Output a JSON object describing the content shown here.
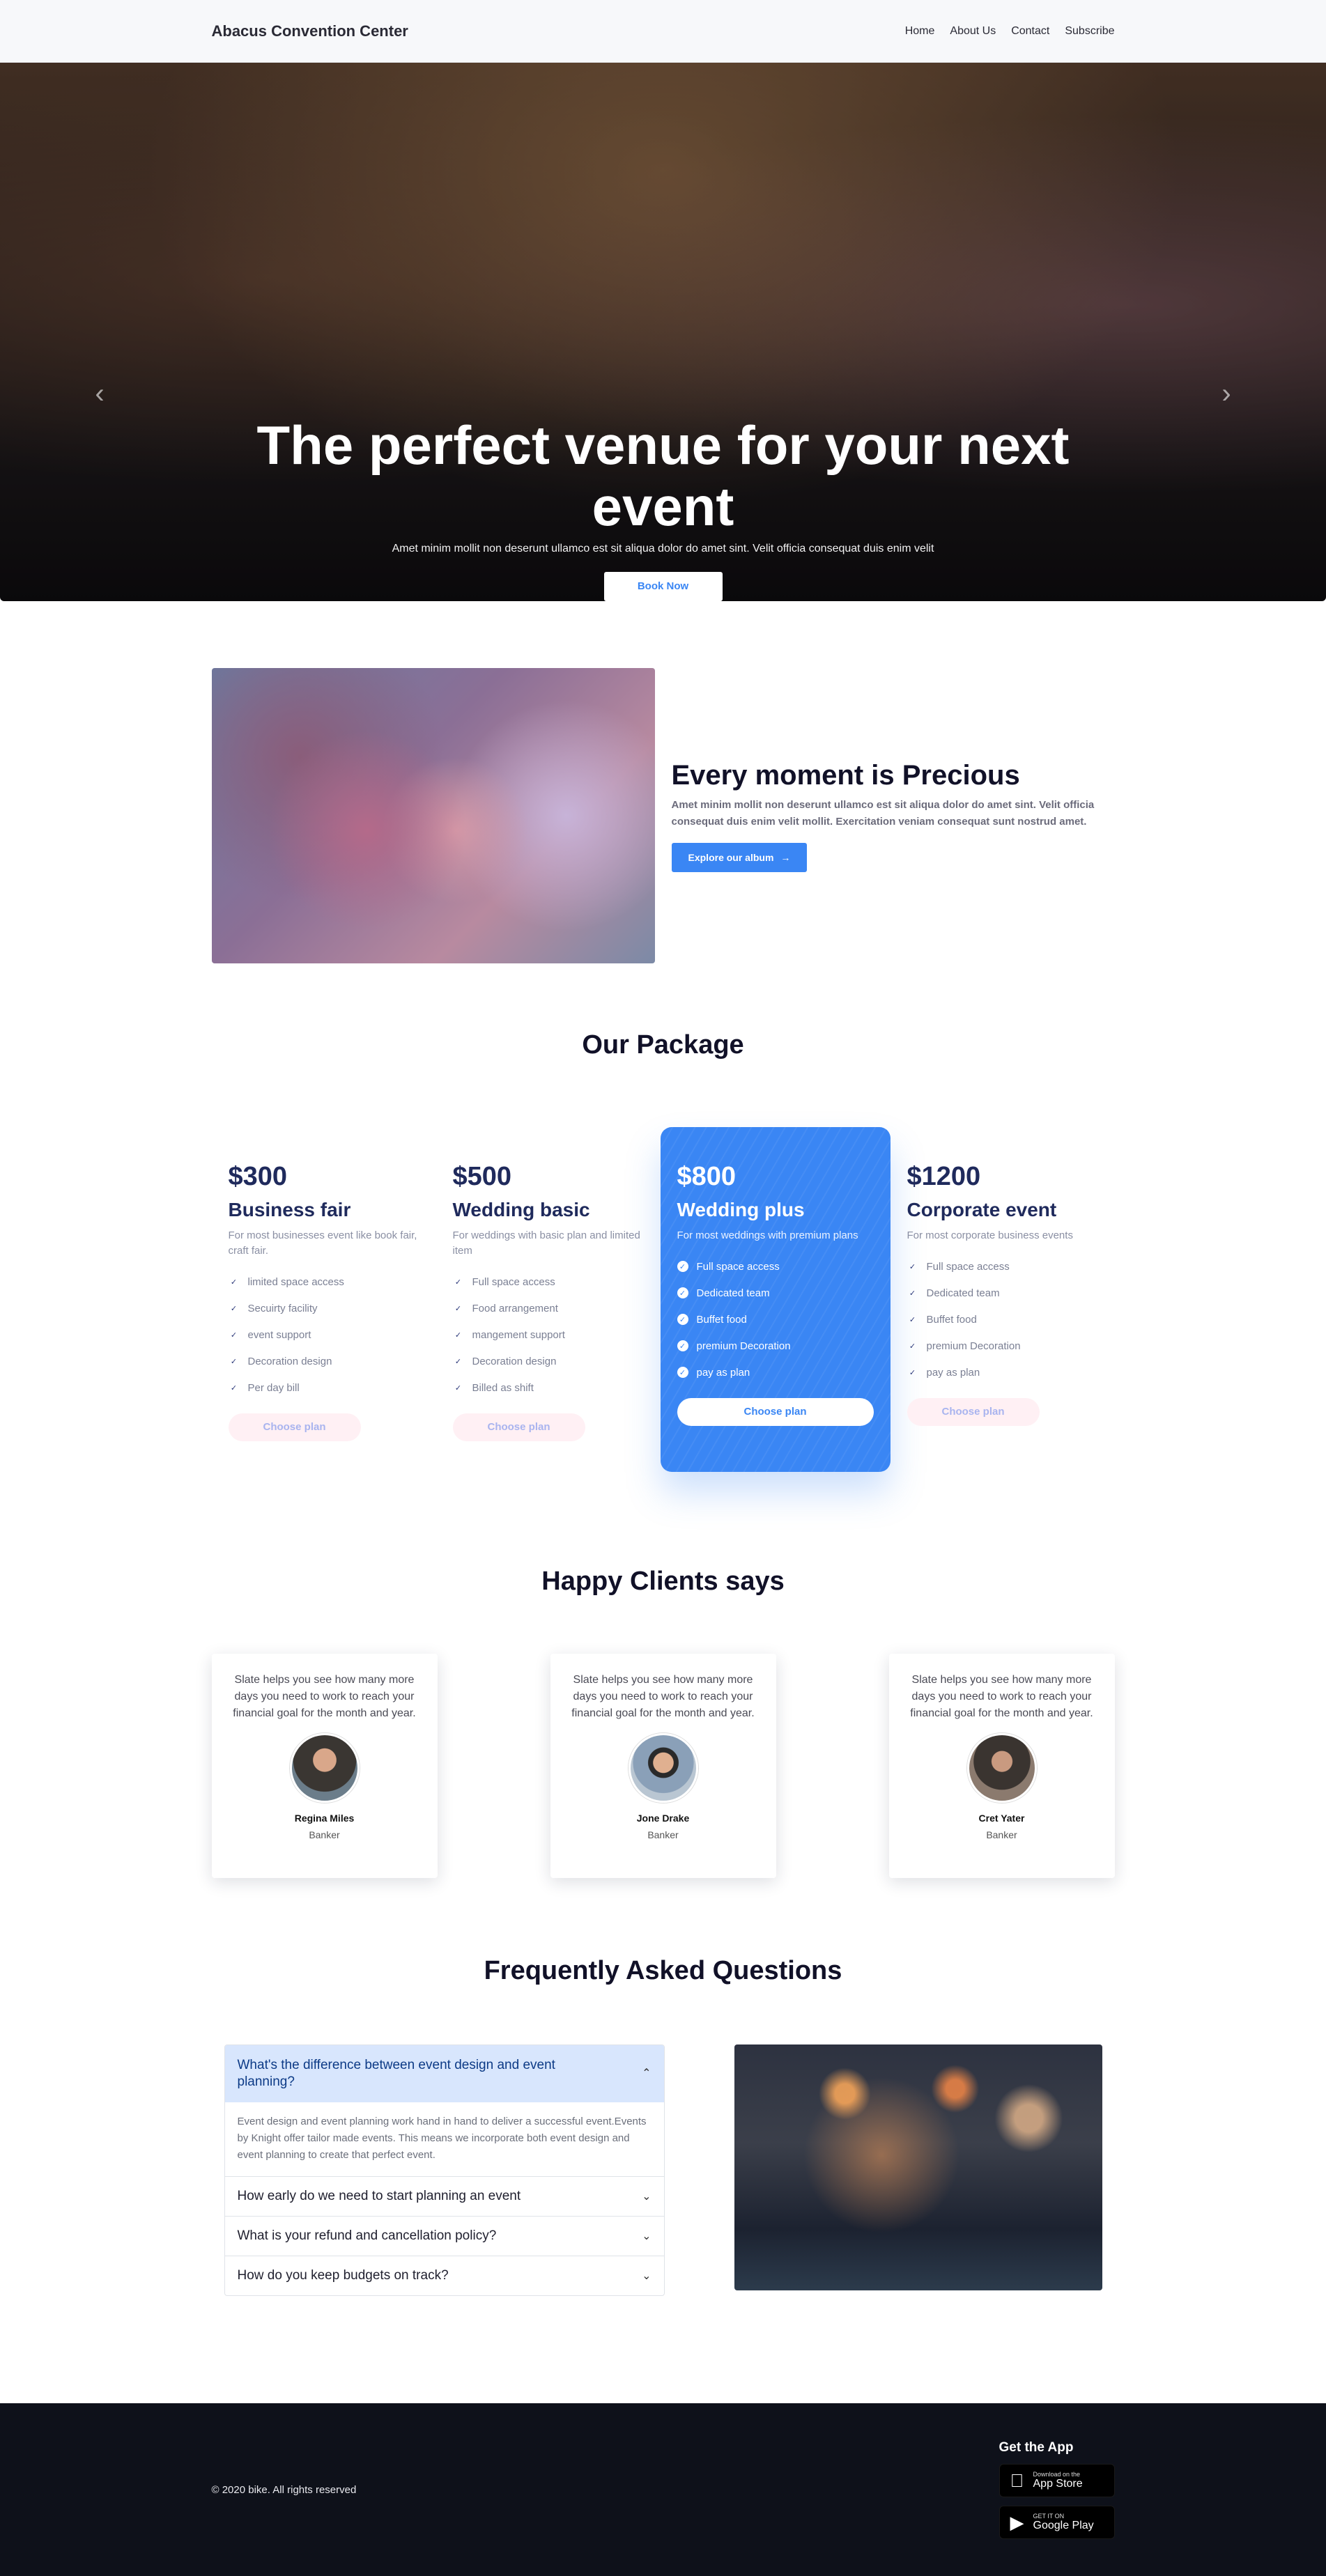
{
  "nav": {
    "brand": "Abacus Convention Center",
    "links": [
      "Home",
      "About Us",
      "Contact",
      "Subscribe"
    ]
  },
  "hero": {
    "title": "The perfect venue for your next event",
    "subtitle": "Amet minim mollit non deserunt ullamco est sit aliqua dolor do amet sint. Velit officia consequat duis enim velit",
    "button": "Book Now",
    "prev_icon": "chevron-left-icon",
    "next_icon": "chevron-right-icon",
    "slide_count": 4,
    "active_slide": 1
  },
  "about": {
    "title": "Every moment is Precious",
    "description": "Amet minim mollit non deserunt ullamco est sit aliqua dolor do amet sint. Velit officia consequat duis enim velit mollit. Exercitation veniam consequat sunt nostrud amet.",
    "button": "Explore our album"
  },
  "packages": {
    "title": "Our Package",
    "items": [
      {
        "price": "$300",
        "name": "Business fair",
        "description": "For most businesses event like book fair, craft fair.",
        "features": [
          "limited space access",
          "Secuirty facility",
          "event support",
          "Decoration design",
          "Per day bill"
        ],
        "button": "Choose plan",
        "featured": false
      },
      {
        "price": "$500",
        "name": "Wedding basic",
        "description": "For weddings with basic plan and limited item",
        "features": [
          "Full space access",
          "Food arrangement",
          "mangement support",
          "Decoration design",
          "Billed as shift"
        ],
        "button": "Choose plan",
        "featured": false
      },
      {
        "price": "$800",
        "name": "Wedding plus",
        "description": "For most weddings with premium plans",
        "features": [
          "Full space access",
          "Dedicated team",
          "Buffet food",
          "premium Decoration",
          "pay as plan"
        ],
        "button": "Choose plan",
        "featured": true
      },
      {
        "price": "$1200",
        "name": "Corporate event",
        "description": "For most corporate business events",
        "features": [
          "Full space access",
          "Dedicated team",
          "Buffet food",
          "premium Decoration",
          "pay as plan"
        ],
        "button": "Choose plan",
        "featured": false
      }
    ]
  },
  "clients": {
    "title": "Happy Clients says",
    "items": [
      {
        "quote": "Slate helps you see how many more days you need to work to reach your financial goal for the month and year.",
        "name": "Regina Miles",
        "role": "Banker"
      },
      {
        "quote": "Slate helps you see how many more days you need to work to reach your financial goal for the month and year.",
        "name": "Jone Drake",
        "role": "Banker"
      },
      {
        "quote": "Slate helps you see how many more days you need to work to reach your financial goal for the month and year.",
        "name": "Cret Yater",
        "role": "Banker"
      }
    ]
  },
  "faq": {
    "title": "Frequently Asked Questions",
    "items": [
      {
        "question": "What's the difference between event design and event planning?",
        "answer": "Event design and event planning work hand in hand to deliver a successful event.Events by Knight offer tailor made events. This means we incorporate both event design and event planning to create that perfect event.",
        "open": true
      },
      {
        "question": "How early do we need to start planning an event",
        "answer": "",
        "open": false
      },
      {
        "question": "What is your refund and cancellation policy?",
        "answer": "",
        "open": false
      },
      {
        "question": "How do you keep budgets on track?",
        "answer": "",
        "open": false
      }
    ]
  },
  "footer": {
    "copyright": "© 2020 bike. All rights reserved",
    "app_title": "Get the App",
    "app_store": {
      "small": "Download on the",
      "big": "App Store",
      "icon": "apple-icon"
    },
    "google_play": {
      "small": "GET IT ON",
      "big": "Google Play",
      "icon": "google-play-icon"
    }
  },
  "colors": {
    "accent": "#3a86f4",
    "dark_text": "#111128",
    "footer_bg": "#0e111a",
    "faq_open_bg": "#d8e6fd",
    "plan_button_bg": "#fff0f4"
  }
}
